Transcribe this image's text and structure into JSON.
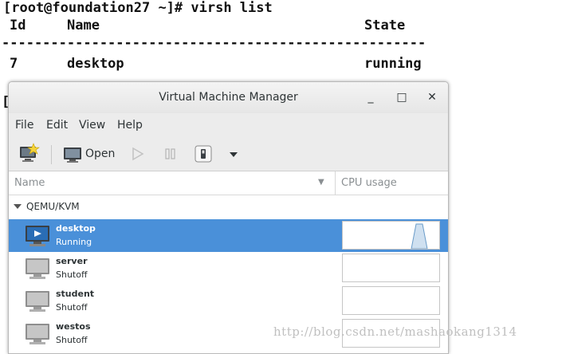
{
  "terminal": {
    "line1": "[root@foundation27 ~]# virsh list",
    "header_id": "Id",
    "header_name": "Name",
    "header_state": "State",
    "divider": "----------------------------------------------------",
    "row_id": "7",
    "row_name": "desktop",
    "row_state": "running",
    "prompt_fragment": "["
  },
  "window": {
    "title": "Virtual Machine Manager",
    "controls": {
      "minimize": "_",
      "maximize": "□",
      "close": "✕"
    }
  },
  "menubar": [
    "File",
    "Edit",
    "View",
    "Help"
  ],
  "toolbar": {
    "new_vm_icon": "new-vm-icon",
    "open_label": "Open",
    "run_icon": "play-icon",
    "pause_icon": "pause-icon",
    "shutdown_icon": "power-icon",
    "more_icon": "chevron-down-icon"
  },
  "columns": {
    "name": "Name",
    "cpu": "CPU usage"
  },
  "group": {
    "label": "QEMU/KVM"
  },
  "vms": [
    {
      "name": "desktop",
      "state": "Running",
      "selected": true
    },
    {
      "name": "server",
      "state": "Shutoff",
      "selected": false
    },
    {
      "name": "student",
      "state": "Shutoff",
      "selected": false
    },
    {
      "name": "westos",
      "state": "Shutoff",
      "selected": false
    }
  ],
  "watermark": "http://blog.csdn.net/mashaokang1314",
  "colors": {
    "selection": "#4a90d9",
    "window_bg": "#ececec"
  }
}
